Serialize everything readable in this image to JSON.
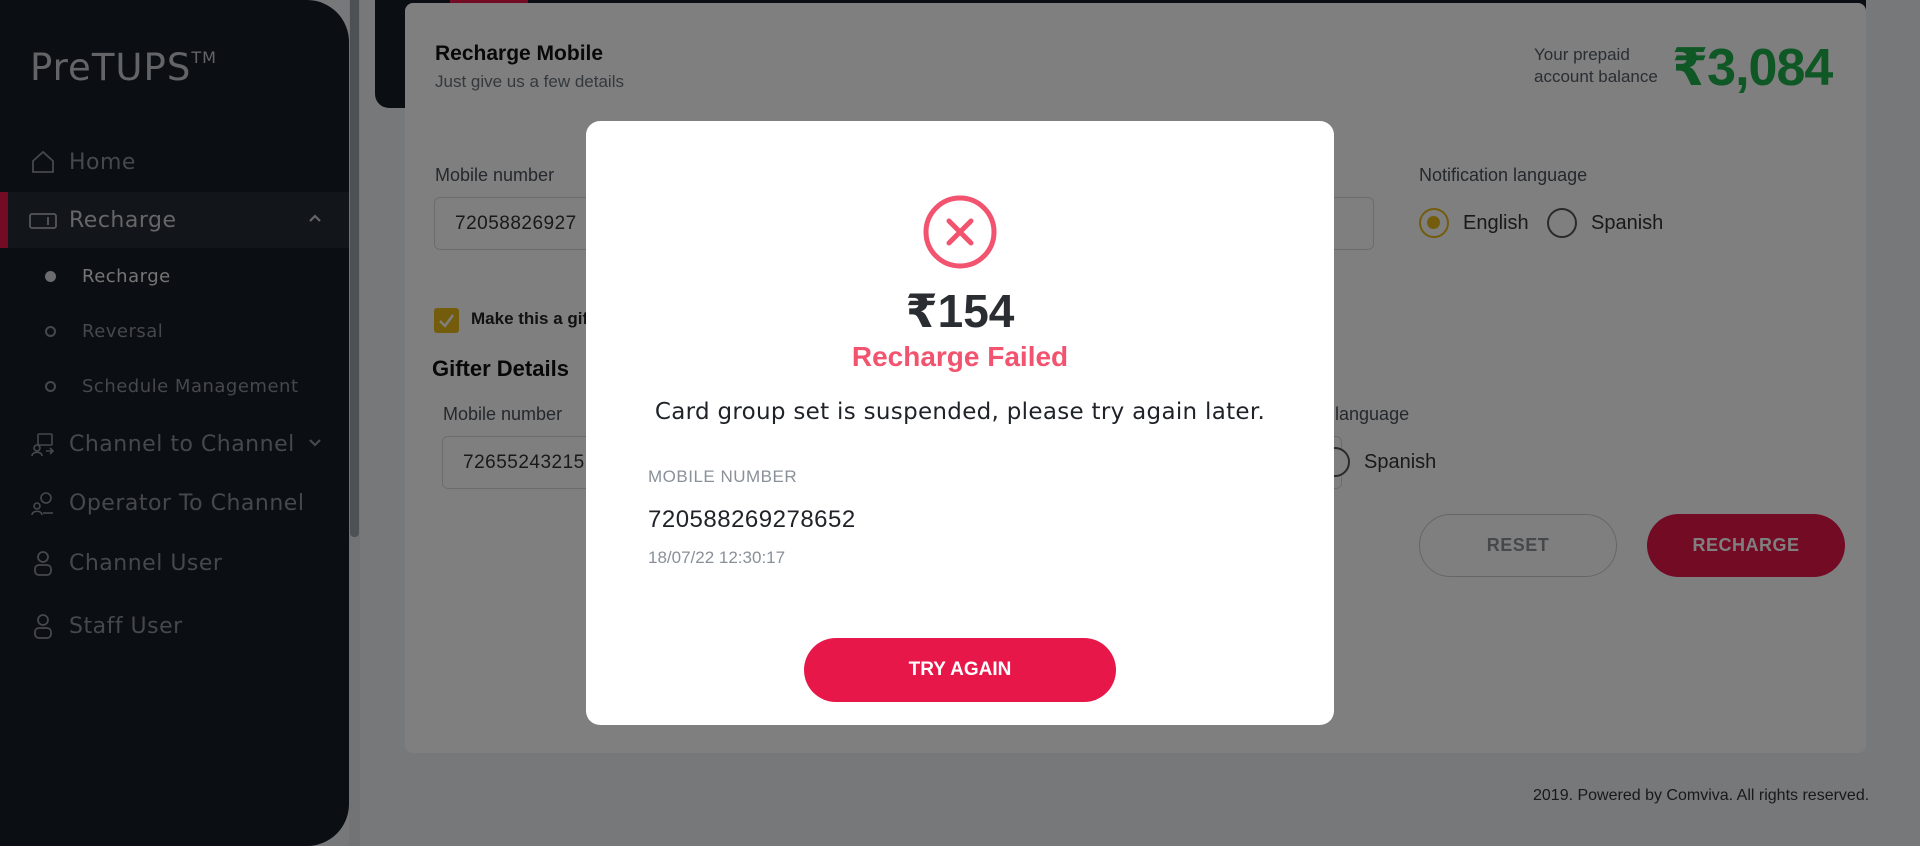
{
  "app": {
    "logo": "PreTUPS",
    "logo_tm": "TM"
  },
  "sidebar": {
    "items": [
      {
        "label": "Home",
        "icon": "home-icon"
      },
      {
        "label": "Recharge",
        "icon": "card-icon"
      },
      {
        "label": "Channel to Channel",
        "icon": "channel-icon"
      },
      {
        "label": "Operator To Channel",
        "icon": "operator-icon"
      },
      {
        "label": "Channel User",
        "icon": "user-icon"
      },
      {
        "label": "Staff User",
        "icon": "user-icon"
      }
    ],
    "sub_items": [
      {
        "label": "Recharge"
      },
      {
        "label": "Reversal"
      },
      {
        "label": "Schedule Management"
      }
    ]
  },
  "page": {
    "title": "Recharge Mobile",
    "subtitle": "Just give us a few details",
    "balance_label_line1": "Your prepaid",
    "balance_label_line2": "account balance",
    "balance_value": "₹3,084"
  },
  "form": {
    "mobile_label": "Mobile number",
    "mobile_value": "72058826927",
    "notification_label": "Notification language",
    "lang_english": "English",
    "lang_spanish": "Spanish",
    "selected_language": "English",
    "gift_checkbox_label": "Make this a gif",
    "gift_checked": true,
    "gifter_section": "Gifter Details",
    "gifter_mobile_label": "Mobile number",
    "gifter_mobile_value": "72655243215",
    "gifter_lang_label_partial": "n language",
    "gifter_lang_spanish": "Spanish",
    "reset_button": "RESET",
    "recharge_button": "RECHARGE"
  },
  "footer": {
    "text": "2019. Powered by Comviva. All rights reserved."
  },
  "modal": {
    "icon": "error-x-icon",
    "amount": "₹154",
    "status": "Recharge Failed",
    "message": "Card group set is suspended, please try again later.",
    "mobile_label": "MOBILE NUMBER",
    "mobile_number": "720588269278652",
    "timestamp": "18/07/22 12:30:17",
    "button": "TRY AGAIN"
  },
  "colors": {
    "accent": "#e8174a",
    "sidebar_bg": "#161c24",
    "balance": "#1fae4b",
    "radio_selected": "#e7b919",
    "error_text": "#f2546f"
  }
}
